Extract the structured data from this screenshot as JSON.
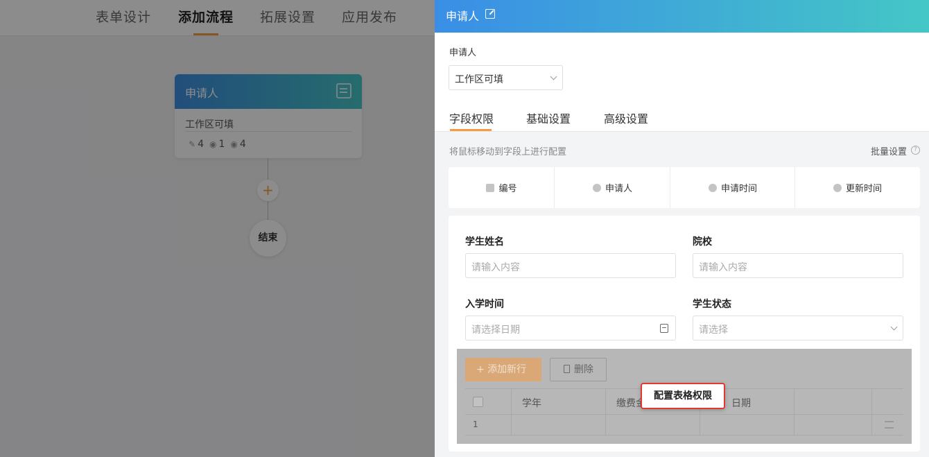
{
  "topnav": {
    "tabs": [
      {
        "label": "表单设计"
      },
      {
        "label": "添加流程"
      },
      {
        "label": "拓展设置"
      },
      {
        "label": "应用发布"
      }
    ]
  },
  "flow": {
    "node": {
      "title": "申请人",
      "subtitle": "工作区可填",
      "stats": {
        "edit": "4",
        "view": "1",
        "hidden": "4"
      }
    },
    "add_symbol": "+",
    "end_label": "结束"
  },
  "drawer": {
    "title": "申请人",
    "applicant_label": "申请人",
    "applicant_select": "工作区可填",
    "tabs": [
      {
        "label": "字段权限"
      },
      {
        "label": "基础设置"
      },
      {
        "label": "高级设置"
      }
    ],
    "hint": "将鼠标移动到字段上进行配置",
    "batch_label": "批量设置",
    "system_fields": [
      {
        "label": "编号",
        "icon": "id-icon"
      },
      {
        "label": "申请人",
        "icon": "person-icon"
      },
      {
        "label": "申请时间",
        "icon": "clock-icon"
      },
      {
        "label": "更新时间",
        "icon": "refresh-clock-icon"
      }
    ],
    "form": {
      "student_name": {
        "label": "学生姓名",
        "placeholder": "请输入内容"
      },
      "school": {
        "label": "院校",
        "placeholder": "请输入内容"
      },
      "enroll_time": {
        "label": "入学时间",
        "placeholder": "请选择日期"
      },
      "student_status": {
        "label": "学生状态",
        "placeholder": "请选择"
      }
    },
    "subtable": {
      "add_row_label": "添加新行",
      "delete_label": "删除",
      "columns": [
        "学年",
        "缴费金",
        "日期"
      ],
      "rows": [
        {
          "index": "1"
        }
      ],
      "popover_label": "配置表格权限"
    }
  }
}
